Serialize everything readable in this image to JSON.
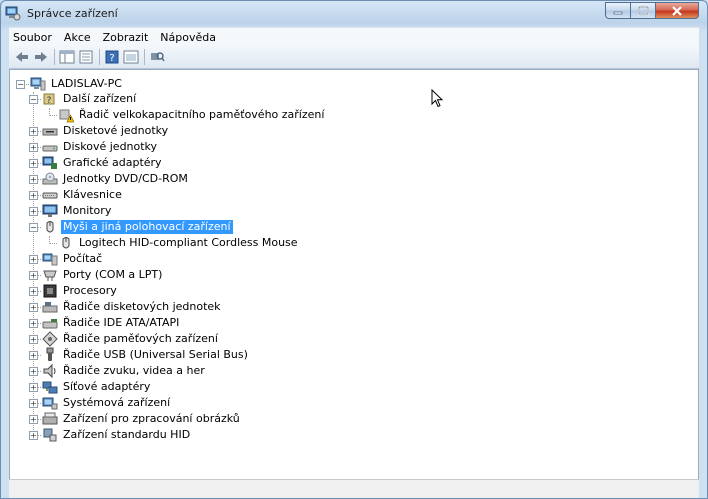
{
  "window": {
    "title": "Správce zařízení"
  },
  "menu": [
    "Soubor",
    "Akce",
    "Zobrazit",
    "Nápověda"
  ],
  "tree": {
    "root": "LADISLAV-PC",
    "dalsi": "Další zařízení",
    "dalsi_child": "Řadič velkokapacitního paměťového zařízení",
    "disketove": "Disketové jednotky",
    "diskove": "Diskové jednotky",
    "graficke": "Grafické adaptéry",
    "dvd": "Jednotky DVD/CD-ROM",
    "klavesnice": "Klávesnice",
    "monitory": "Monitory",
    "mysi": "Myši a jiná polohovací zařízení",
    "mysi_child": "Logitech HID-compliant Cordless Mouse",
    "pocitac": "Počítač",
    "porty": "Porty (COM a LPT)",
    "procesory": "Procesory",
    "radice_disket": "Řadiče disketových jednotek",
    "radice_ide": "Řadiče IDE ATA/ATAPI",
    "radice_pamet": "Řadiče paměťových zařízení",
    "radice_usb": "Řadiče USB (Universal Serial Bus)",
    "radice_zvuk": "Řadiče zvuku, videa a her",
    "sitove": "Síťové adaptéry",
    "systemova": "Systémová zařízení",
    "obrazky": "Zařízení pro zpracování obrázků",
    "hid": "Zařízení standardu HID"
  },
  "colors": {
    "selection": "#3399ff",
    "frame": "#bcd3ea"
  }
}
